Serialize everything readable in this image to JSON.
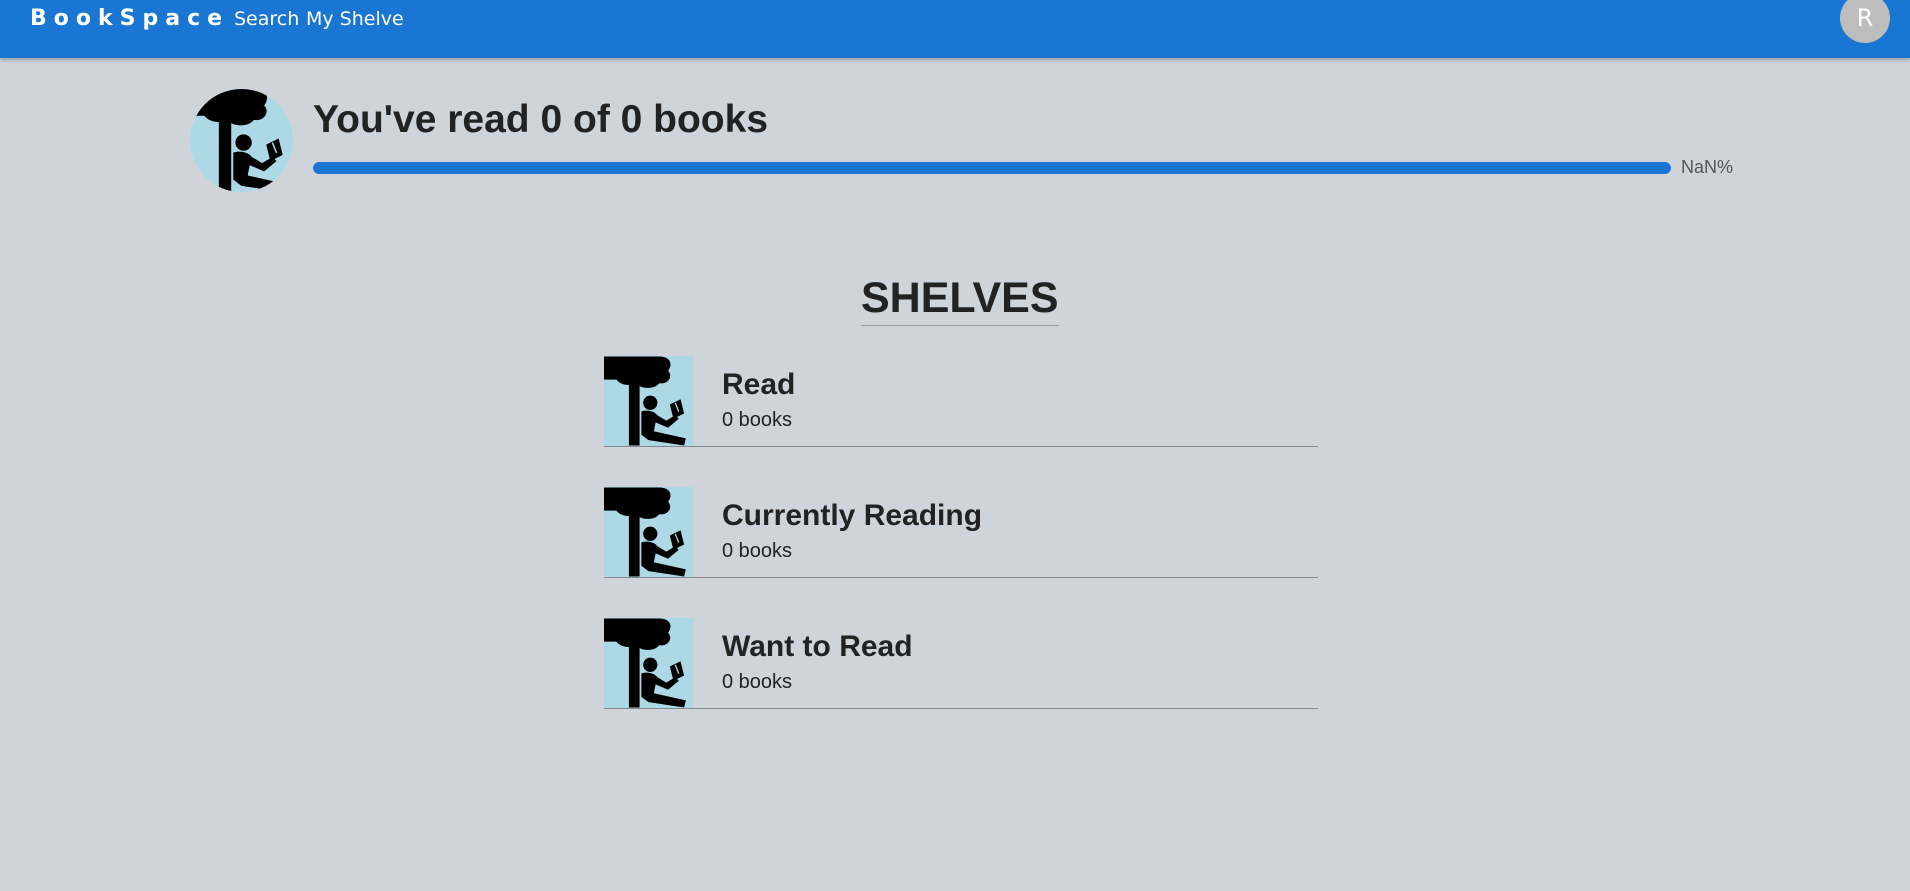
{
  "header": {
    "brand": "BookSpace",
    "nav": [
      "Search",
      "My Shelve"
    ],
    "avatar_initial": "R",
    "bar_color": "#1976d2"
  },
  "progress": {
    "title": "You've read 0 of 0 books",
    "percent_label": "NaN%",
    "fill_fraction": 1.0
  },
  "shelves": {
    "heading": "SHELVES",
    "items": [
      {
        "name": "Read",
        "count": "0 books",
        "icon": "reading-person-icon"
      },
      {
        "name": "Currently Reading",
        "count": "0 books",
        "icon": "reading-person-icon"
      },
      {
        "name": "Want to Read",
        "count": "0 books",
        "icon": "reading-person-icon"
      }
    ]
  }
}
